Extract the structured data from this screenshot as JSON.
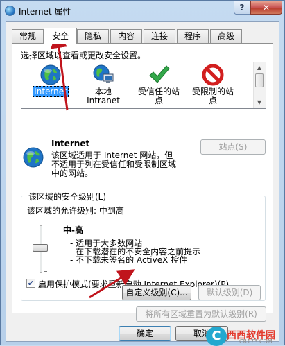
{
  "window": {
    "title": "Internet 属性",
    "help": "?",
    "close": "✕"
  },
  "tabs": [
    {
      "label": "常规"
    },
    {
      "label": "安全"
    },
    {
      "label": "隐私"
    },
    {
      "label": "内容"
    },
    {
      "label": "连接"
    },
    {
      "label": "程序"
    },
    {
      "label": "高级"
    }
  ],
  "security": {
    "zone_prompt": "选择区域以查看或更改安全设置。",
    "zones": [
      {
        "label": "Internet",
        "icon": "globe-icon"
      },
      {
        "label": "本地\nIntranet",
        "icon": "intranet-icon"
      },
      {
        "label": "受信任的站\n点",
        "icon": "checkmark-icon"
      },
      {
        "label": "受限制的站\n点",
        "icon": "restricted-icon"
      }
    ],
    "selected_zone_name": "Internet",
    "zone_description": "该区域适用于 Internet 网站，但\n不适用于列在受信任和受限制区域\n中的网站。",
    "sites_button": "站点(S)",
    "level_group_title": "该区域的安全级别(L)",
    "allowed_levels": "该区域的允许级别: 中到高",
    "level_name": "中-高",
    "level_bullets": [
      "- 适用于大多数网站",
      "- 在下载潜在的不安全内容之前提示",
      "- 不下载未签名的 ActiveX 控件"
    ],
    "protected_mode": {
      "label": "启用保护模式(要求重新启动 Internet Explorer)(P)",
      "checked": true
    },
    "custom_level_button": "自定义级别(C)...",
    "default_level_button": "默认级别(D)",
    "reset_all_button": "将所有区域重置为默认级别(R)"
  },
  "footer": {
    "ok": "确定",
    "cancel": "取消"
  },
  "watermark": {
    "logo_glyph": "C",
    "text": "西西软件园",
    "sub": "CR173.COM"
  },
  "colors": {
    "annotation_arrow": "#c0141c",
    "selection": "#3399ff"
  }
}
